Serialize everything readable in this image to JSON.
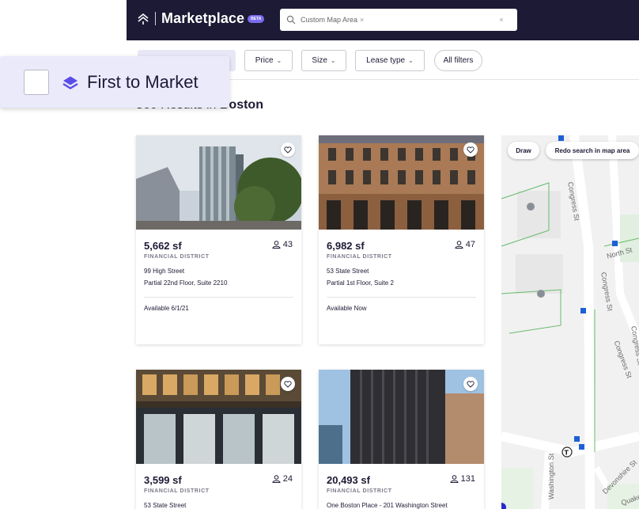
{
  "header": {
    "brand": "Marketplace",
    "beta_badge": "BETA",
    "search_chip": "Custom Map Area",
    "search_chip_remove": "×",
    "search_clear": "×"
  },
  "filters": {
    "first_to_market": "First to Market",
    "price": "Price",
    "size": "Size",
    "lease_type": "Lease type",
    "all_filters": "All filters"
  },
  "results": {
    "count": "360",
    "text": "Results in",
    "city": "Boston"
  },
  "listings": [
    {
      "size": "5,662 sf",
      "people": "43",
      "district": "FINANCIAL DISTRICT",
      "address": "99 High Street",
      "suite": "Partial 22nd Floor, Suite 2210",
      "availability": "Available 6/1/21"
    },
    {
      "size": "6,982 sf",
      "people": "47",
      "district": "FINANCIAL DISTRICT",
      "address": "53 State Street",
      "suite": "Partial 1st Floor, Suite 2",
      "availability": "Available Now"
    },
    {
      "size": "3,599 sf",
      "people": "24",
      "district": "FINANCIAL DISTRICT",
      "address": "53 State Street"
    },
    {
      "size": "20,493 sf",
      "people": "131",
      "district": "FINANCIAL DISTRICT",
      "address": "One Boston Place - 201 Washington Street"
    }
  ],
  "map": {
    "draw": "Draw",
    "redo": "Redo search in map area",
    "streets": [
      "Congress St",
      "North St",
      "Congress St",
      "Congress St",
      "Congress St",
      "Washington St",
      "Devonshire St",
      "Quaker"
    ]
  },
  "colors": {
    "topbar": "#1c1a35",
    "accent": "#7a6cf0",
    "filter_highlight": "#e7e7f6"
  }
}
